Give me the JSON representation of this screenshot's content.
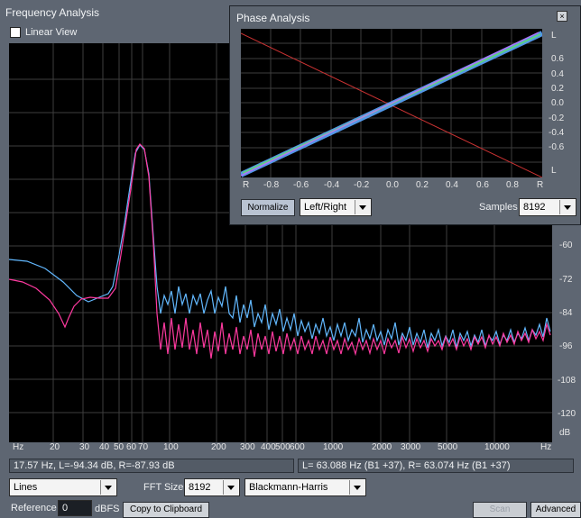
{
  "freq": {
    "title": "Frequency Analysis",
    "linear_view_label": "Linear View",
    "y_ticks": [
      "-60",
      "-72",
      "-84",
      "-96",
      "-108",
      "-120",
      "dB"
    ],
    "x_ticks": [
      "Hz",
      "20",
      "30",
      "40",
      "50",
      "60",
      "70",
      "100",
      "200",
      "300",
      "400",
      "500",
      "600",
      "1000",
      "2000",
      "3000",
      "5000",
      "10000",
      "Hz"
    ],
    "status_left": "17.57 Hz, L=-94.34 dB, R=-87.93 dB",
    "status_right": "L= 63.088 Hz (B1 +37), R= 63.074 Hz (B1 +37)",
    "graph_mode": "Lines",
    "fft_size_label": "FFT Size",
    "fft_size": "8192",
    "window": "Blackmann-Harris",
    "reference_label": "Reference",
    "reference_value": "0",
    "dbfs_label": "dBFS",
    "copy_label": "Copy to Clipboard",
    "scan_label": "Scan",
    "advanced_label": "Advanced",
    "colors": {
      "left": "#ff3aa0",
      "right": "#62b8ff"
    }
  },
  "phase": {
    "title": "Phase Analysis",
    "y_ticks": [
      "L",
      "0.6",
      "0.4",
      "0.2",
      "0.0",
      "-0.2",
      "-0.4",
      "-0.6",
      "L"
    ],
    "x_ticks": [
      "R",
      "-0.8",
      "-0.6",
      "-0.4",
      "-0.2",
      "0.0",
      "0.2",
      "0.4",
      "0.6",
      "0.8",
      "R"
    ],
    "normalize_label": "Normalize",
    "channel_mode": "Left/Right",
    "samples_label": "Samples",
    "samples": "8192"
  }
}
